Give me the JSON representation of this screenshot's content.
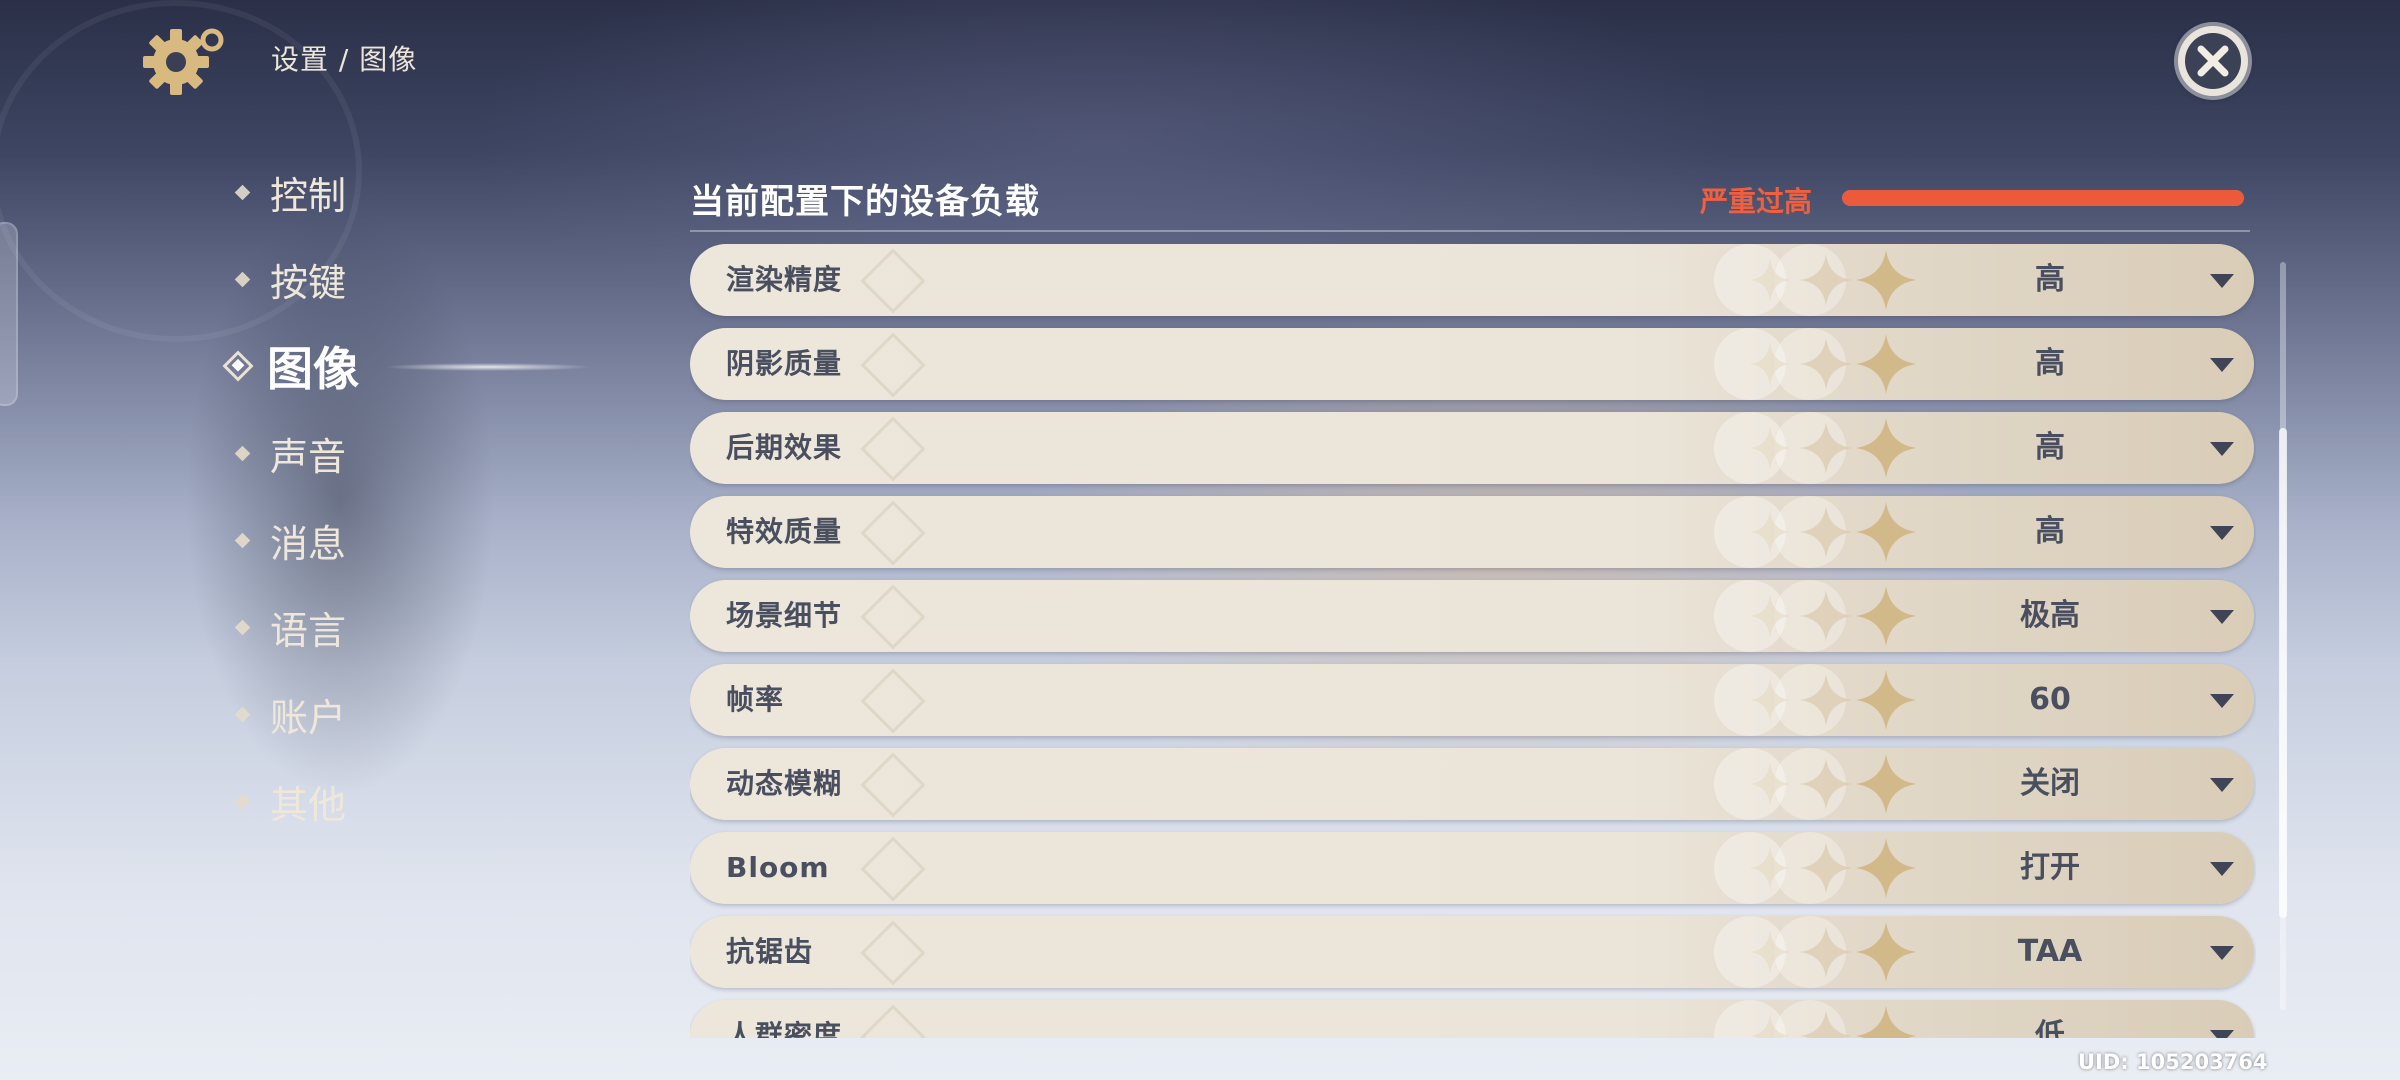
{
  "header": {
    "breadcrumb": "设置 / 图像",
    "close_icon": "close-icon"
  },
  "nav": {
    "items": [
      {
        "label": "控制",
        "active": false
      },
      {
        "label": "按键",
        "active": false
      },
      {
        "label": "图像",
        "active": true
      },
      {
        "label": "声音",
        "active": false
      },
      {
        "label": "消息",
        "active": false
      },
      {
        "label": "语言",
        "active": false
      },
      {
        "label": "账户",
        "active": false
      },
      {
        "label": "其他",
        "active": false
      }
    ]
  },
  "load": {
    "title": "当前配置下的设备负载",
    "status": "严重过高",
    "status_color": "#ec5a3c",
    "level": 1.0
  },
  "settings": [
    {
      "label": "渲染精度",
      "value": "高"
    },
    {
      "label": "阴影质量",
      "value": "高"
    },
    {
      "label": "后期效果",
      "value": "高"
    },
    {
      "label": "特效质量",
      "value": "高"
    },
    {
      "label": "场景细节",
      "value": "极高"
    },
    {
      "label": "帧率",
      "value": "60"
    },
    {
      "label": "动态模糊",
      "value": "关闭"
    },
    {
      "label": "Bloom",
      "value": "打开"
    },
    {
      "label": "抗锯齿",
      "value": "TAA"
    },
    {
      "label": "人群密度",
      "value": "低"
    }
  ],
  "footer": {
    "uid": "UID: 105203764"
  }
}
